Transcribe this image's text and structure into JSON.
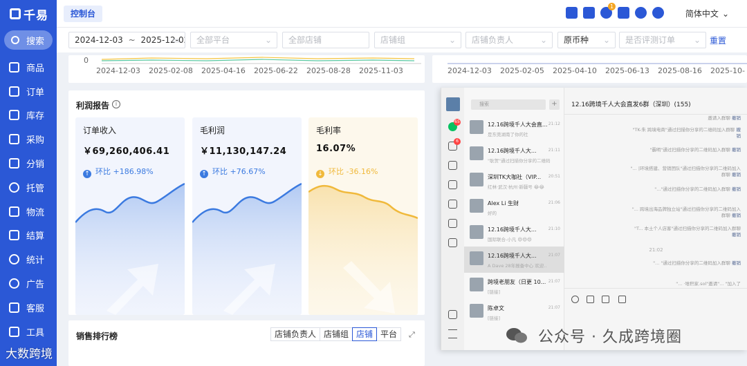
{
  "app": {
    "logo_text": "千易",
    "search_label": "搜索"
  },
  "sidebar": {
    "items": [
      {
        "label": "商品"
      },
      {
        "label": "订单"
      },
      {
        "label": "库存"
      },
      {
        "label": "采购"
      },
      {
        "label": "分销"
      },
      {
        "label": "托管"
      },
      {
        "label": "物流"
      },
      {
        "label": "结算"
      },
      {
        "label": "统计"
      },
      {
        "label": "广告"
      },
      {
        "label": "客服"
      },
      {
        "label": "工具"
      }
    ]
  },
  "topbar": {
    "tab_label": "控制台",
    "notification_count": "1",
    "language": "简体中文"
  },
  "filters": {
    "date_start": "2024-12-03",
    "date_sep": "~",
    "date_end": "2025-12-02",
    "platform_placeholder": "全部平台",
    "store_placeholder": "全部店铺",
    "store_group_placeholder": "店铺组",
    "store_owner_placeholder": "店铺负责人",
    "currency_value": "原币种",
    "eval_order_placeholder": "是否评测订单",
    "reset_label": "重置"
  },
  "top_chart_left": {
    "ticks": [
      "2024-12-03",
      "2025-02-08",
      "2025-04-16",
      "2025-06-22",
      "2025-08-28",
      "2025-11-03"
    ],
    "zero": "0"
  },
  "top_chart_right": {
    "ticks": [
      "2024-12-03",
      "2025-02-05",
      "2025-04-10",
      "2025-06-13",
      "2025-08-16",
      "2025-10-"
    ]
  },
  "profit_report": {
    "title": "利润报告",
    "metrics": [
      {
        "name": "订单收入",
        "value": "￥69,260,406.41",
        "compare_label": "环比",
        "compare_value": "+186.98%",
        "trend": "up",
        "color": "#3b7ae0"
      },
      {
        "name": "毛利润",
        "value": "￥11,130,147.24",
        "compare_label": "环比",
        "compare_value": "+76.67%",
        "trend": "up",
        "color": "#3b7ae0"
      },
      {
        "name": "毛利率",
        "value": "16.07%",
        "compare_label": "环比",
        "compare_value": "-36.16%",
        "trend": "down",
        "color": "#f0b93b"
      }
    ]
  },
  "sales_ranking": {
    "title": "销售排行榜",
    "tabs": [
      "店铺负责人",
      "店铺组",
      "店铺",
      "平台"
    ],
    "active_tab": 2
  },
  "chat": {
    "search_placeholder": "搜索",
    "rail_badges": [
      "65",
      "6"
    ],
    "header": "12.16跨境千人大会直发6群（深圳）(155)",
    "conversations": [
      {
        "name": "12.16跨境千人大会直...",
        "time": "21:12",
        "preview": "是东莞湖南了你的社"
      },
      {
        "name": "12.16跨境千人大...",
        "time": "21:11",
        "preview": "\"耿贺\"通过扫描你分享的二维码",
        "selected": false
      },
      {
        "name": "深圳TK大咖社（VIP...",
        "time": "20:51",
        "preview": "红林·武汉·杭州·新疆号 😂😂"
      },
      {
        "name": "Alex Li 生财",
        "time": "21:06",
        "preview": "好的"
      },
      {
        "name": "12.16跨境千人大...",
        "time": "21:10",
        "preview": "国际联合-小凡 😄😄😄"
      },
      {
        "name": "12.16跨境千人大...",
        "time": "21:07",
        "preview": "A Dave 28年报备中心 欢迎..",
        "selected": true
      },
      {
        "name": "跨境老朋友（日更 10...",
        "time": "21:07",
        "preview": "[链接]"
      },
      {
        "name": "陈卓文",
        "time": "21:07",
        "preview": "[链接]"
      }
    ],
    "messages": [
      {
        "text": "邀请入群聊",
        "link": "撤销"
      },
      {
        "text": "\"TK-朱 跨境电商\"通过扫描你分享的二维码加入群聊",
        "link": "撤销"
      },
      {
        "text": "\"霸明\"通过扫描你分享的二维码加入群聊",
        "link": "撤销"
      },
      {
        "text": "\"... |环境搭建、营销团队\"通过扫描你分享的二维码加入群聊",
        "link": "撤销"
      },
      {
        "text": "\"...\"通过扫描你分享的二维码加入群聊",
        "link": "撤销"
      },
      {
        "text": "\"... 跨境出海品牌独立站\"通过扫描你分享的二维码加入群聊",
        "link": "撤销"
      },
      {
        "text": "\"T... 本土个人店客\"通过扫描你分享的二维码加入群聊",
        "link": "撤销"
      },
      {
        "text": "\"... \"通过扫描你分享的二维码加入群聊",
        "link": "撤销"
      },
      {
        "text": "\"... ·堆积家.sol\"邀请\"... \"加入了"
      }
    ],
    "time_mark": "21:02"
  },
  "watermarks": {
    "right": "公众号 · 久成跨境圈",
    "left": "大数跨境"
  }
}
